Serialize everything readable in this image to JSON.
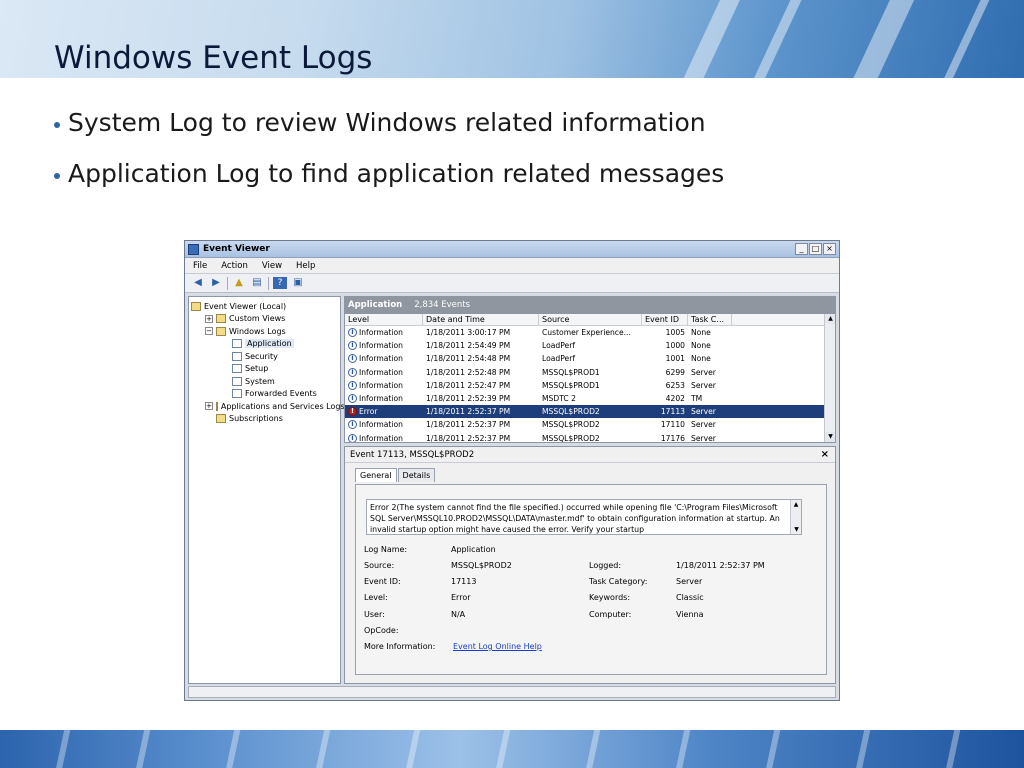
{
  "slide": {
    "title": "Windows Event Logs",
    "bullets": [
      "System Log to review Windows related information",
      "Application Log to find application related messages"
    ]
  },
  "window": {
    "title": "Event Viewer",
    "controls": [
      "_",
      "□",
      "×"
    ],
    "menu": [
      "File",
      "Action",
      "View",
      "Help"
    ],
    "toolbar_icons": [
      "back-arrow-icon",
      "forward-arrow-icon",
      "up-folder-icon",
      "properties-icon",
      "help-icon",
      "show-hide-pane-icon"
    ],
    "tree": [
      {
        "label": "Event Viewer (Local)",
        "level": 0,
        "expander": "",
        "icon": "event-viewer-icon"
      },
      {
        "label": "Custom Views",
        "level": 1,
        "expander": "+",
        "icon": "folder-icon"
      },
      {
        "label": "Windows Logs",
        "level": 1,
        "expander": "−",
        "icon": "folder-icon"
      },
      {
        "label": "Application",
        "level": 2,
        "expander": "",
        "icon": "log-icon",
        "selected": true
      },
      {
        "label": "Security",
        "level": 2,
        "expander": "",
        "icon": "log-icon"
      },
      {
        "label": "Setup",
        "level": 2,
        "expander": "",
        "icon": "log-icon"
      },
      {
        "label": "System",
        "level": 2,
        "expander": "",
        "icon": "log-icon"
      },
      {
        "label": "Forwarded Events",
        "level": 2,
        "expander": "",
        "icon": "log-icon"
      },
      {
        "label": "Applications and Services Logs",
        "level": 1,
        "expander": "+",
        "icon": "folder-icon"
      },
      {
        "label": "Subscriptions",
        "level": 1,
        "expander": "",
        "icon": "folder-icon"
      }
    ],
    "list": {
      "title": "Application",
      "count": "2,834 Events",
      "columns": [
        "Level",
        "Date and Time",
        "Source",
        "Event ID",
        "Task C..."
      ],
      "rows": [
        {
          "level": "Information",
          "date": "1/18/2011 3:00:17 PM",
          "source": "Customer Experience...",
          "id": "1005",
          "task": "None",
          "type": "info"
        },
        {
          "level": "Information",
          "date": "1/18/2011 2:54:49 PM",
          "source": "LoadPerf",
          "id": "1000",
          "task": "None",
          "type": "info"
        },
        {
          "level": "Information",
          "date": "1/18/2011 2:54:48 PM",
          "source": "LoadPerf",
          "id": "1001",
          "task": "None",
          "type": "info"
        },
        {
          "level": "Information",
          "date": "1/18/2011 2:52:48 PM",
          "source": "MSSQL$PROD1",
          "id": "6299",
          "task": "Server",
          "type": "info"
        },
        {
          "level": "Information",
          "date": "1/18/2011 2:52:47 PM",
          "source": "MSSQL$PROD1",
          "id": "6253",
          "task": "Server",
          "type": "info"
        },
        {
          "level": "Information",
          "date": "1/18/2011 2:52:39 PM",
          "source": "MSDTC 2",
          "id": "4202",
          "task": "TM",
          "type": "info"
        },
        {
          "level": "Error",
          "date": "1/18/2011 2:52:37 PM",
          "source": "MSSQL$PROD2",
          "id": "17113",
          "task": "Server",
          "type": "error",
          "selected": true
        },
        {
          "level": "Information",
          "date": "1/18/2011 2:52:37 PM",
          "source": "MSSQL$PROD2",
          "id": "17110",
          "task": "Server",
          "type": "info"
        },
        {
          "level": "Information",
          "date": "1/18/2011 2:52:37 PM",
          "source": "MSSQL$PROD2",
          "id": "17176",
          "task": "Server",
          "type": "info"
        }
      ]
    },
    "detail": {
      "header": "Event 17113, MSSQL$PROD2",
      "close": "×",
      "tabs": [
        "General",
        "Details"
      ],
      "message": "Error 2(The system cannot find the file specified.) occurred while opening file 'C:\\Program Files\\Microsoft SQL Server\\MSSQL10.PROD2\\MSSQL\\DATA\\master.mdf' to obtain configuration information at startup. An invalid startup option might have caused the error. Verify your startup",
      "props": {
        "log_name_label": "Log Name:",
        "log_name": "Application",
        "source_label": "Source:",
        "source": "MSSQL$PROD2",
        "logged_label": "Logged:",
        "logged": "1/18/2011 2:52:37 PM",
        "event_id_label": "Event ID:",
        "event_id": "17113",
        "task_category_label": "Task Category:",
        "task_category": "Server",
        "level_label": "Level:",
        "level": "Error",
        "keywords_label": "Keywords:",
        "keywords": "Classic",
        "user_label": "User:",
        "user": "N/A",
        "computer_label": "Computer:",
        "computer": "Vienna",
        "opcode_label": "OpCode:",
        "more_info_label": "More Information:",
        "more_info_link": "Event Log Online Help"
      }
    }
  }
}
